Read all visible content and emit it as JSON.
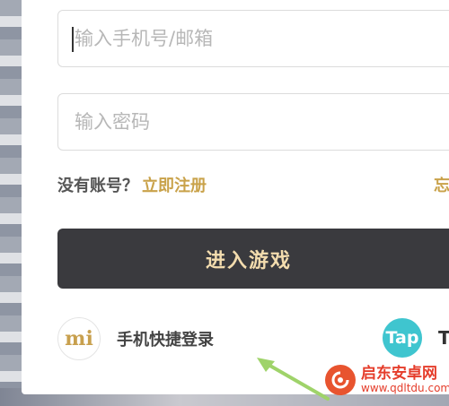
{
  "login": {
    "account_placeholder": "输入手机号/邮箱",
    "password_placeholder": "输入密码",
    "no_account_text": "没有账号？",
    "register_link": "立即注册",
    "forgot_partial": "忘",
    "enter_game_button": "进入游戏"
  },
  "quick_login": {
    "mi_logo_text": "mi",
    "mi_label": "手机快捷登录",
    "tap_logo_text": "Tap",
    "tap_label": "T"
  },
  "watermark": {
    "title": "启东安卓网",
    "url": "www.qdltdu.com"
  },
  "colors": {
    "accent_gold": "#c9a24a",
    "button_dark": "#3a3a3e",
    "button_text": "#f3dcae",
    "tap_teal": "#3fc5cf",
    "arrow_green": "#9fd36a"
  }
}
